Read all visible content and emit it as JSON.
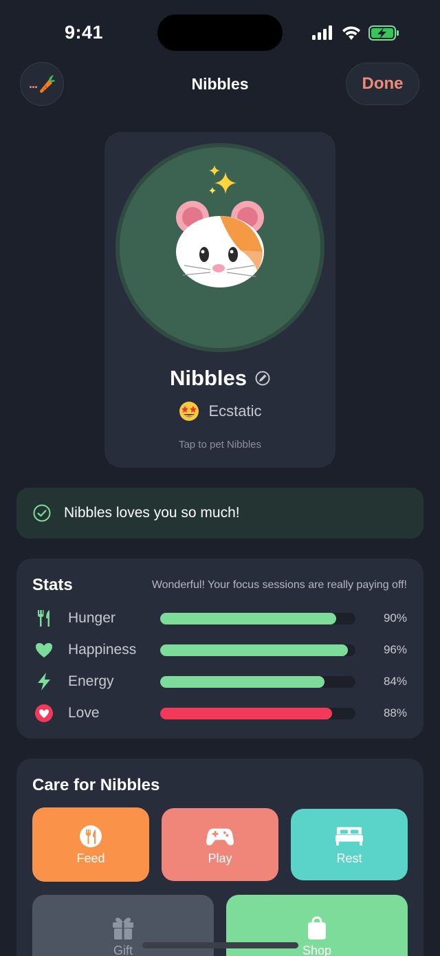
{
  "status_bar": {
    "time": "9:41"
  },
  "nav": {
    "pet_switch_label": "...",
    "title": "Nibbles",
    "done_label": "Done"
  },
  "pet": {
    "name": "Nibbles",
    "mood": "Ecstatic",
    "tap_hint": "Tap to pet Nibbles"
  },
  "banner": {
    "message": "Nibbles loves you so much!"
  },
  "stats": {
    "title": "Stats",
    "subtitle": "Wonderful! Your focus sessions are really paying off!",
    "items": [
      {
        "label": "Hunger",
        "value": 90,
        "value_text": "90%",
        "icon": "fork-knife-icon",
        "color": "#7ddc9a"
      },
      {
        "label": "Happiness",
        "value": 96,
        "value_text": "96%",
        "icon": "heart-icon",
        "color": "#7ddc9a"
      },
      {
        "label": "Energy",
        "value": 84,
        "value_text": "84%",
        "icon": "bolt-icon",
        "color": "#7ddc9a"
      },
      {
        "label": "Love",
        "value": 88,
        "value_text": "88%",
        "icon": "love-heart-icon",
        "color": "#f3395a"
      }
    ]
  },
  "care": {
    "title": "Care for Nibbles",
    "actions": [
      {
        "label": "Feed",
        "icon": "fork-knife-icon",
        "color": "#fa9349"
      },
      {
        "label": "Play",
        "icon": "gamepad-icon",
        "color": "#f0857a"
      },
      {
        "label": "Rest",
        "icon": "bed-icon",
        "color": "#5ad4c9"
      },
      {
        "label": "Gift",
        "icon": "gift-icon",
        "color": "#4d5563"
      },
      {
        "label": "Shop",
        "icon": "shopping-bag-icon",
        "color": "#7ddc9a"
      }
    ]
  },
  "colors": {
    "accent": "#f08a78",
    "background": "#1c202b",
    "card": "#272d3b",
    "green": "#7ddc9a",
    "red": "#f3395a"
  }
}
